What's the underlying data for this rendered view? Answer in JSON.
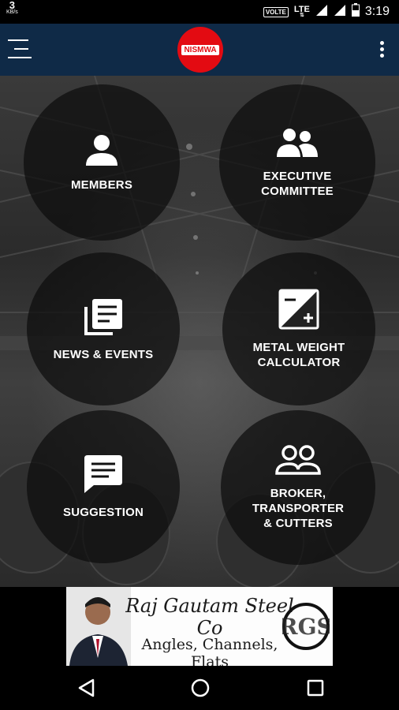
{
  "status_bar": {
    "net_speed_value": "3",
    "net_speed_unit": "KB/s",
    "volte": "VOLTE",
    "network": "LTE",
    "roaming": "R",
    "time": "3:19"
  },
  "app_bar": {
    "logo_text": "NISMWA"
  },
  "tiles": [
    {
      "label": "MEMBERS",
      "icon": "person-icon"
    },
    {
      "label": "EXECUTIVE COMMITTEE",
      "icon": "group-icon"
    },
    {
      "label": "NEWS & EVENTS",
      "icon": "news-icon"
    },
    {
      "label": "METAL WEIGHT CALCULATOR",
      "icon": "calculator-icon"
    },
    {
      "label": "SUGGESTION",
      "icon": "chat-message-icon"
    },
    {
      "label": "BROKER, TRANSPORTER & CUTTERS",
      "icon": "people-outline-icon"
    }
  ],
  "ad_banner": {
    "company": "Raj Gautam Steel Co",
    "products": "Angles, Channels, Flats",
    "monogram": "RGS"
  },
  "colors": {
    "app_bar": "#0f2a47",
    "logo_red": "#e30b12"
  }
}
